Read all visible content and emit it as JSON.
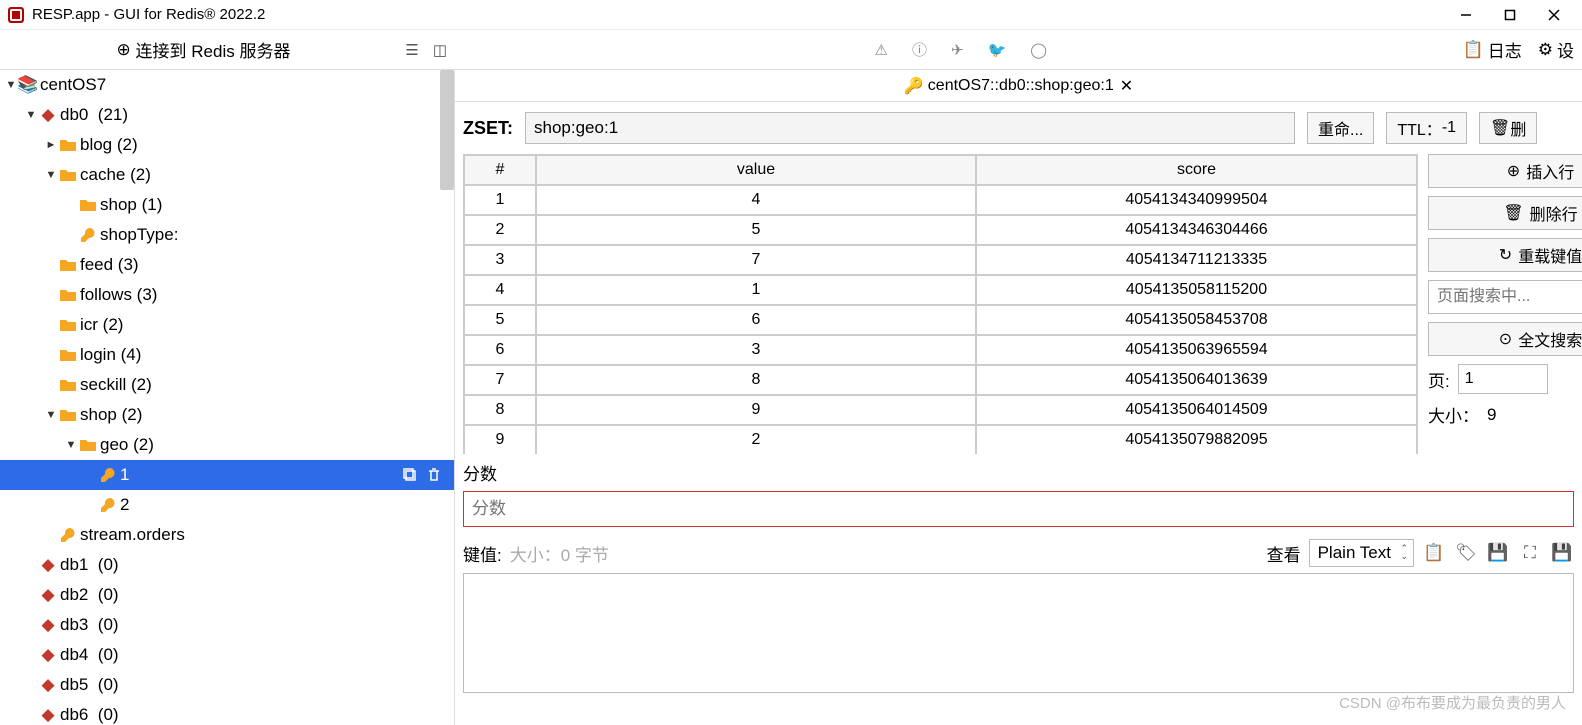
{
  "window": {
    "title": "RESP.app - GUI for Redis® 2022.2"
  },
  "toolbar": {
    "connect": "连接到 Redis 服务器",
    "log": "日志",
    "settings": "设"
  },
  "tree": {
    "server": "centOS7",
    "dbs": [
      {
        "name": "db0",
        "count": "(21)",
        "expanded": true,
        "children": [
          {
            "type": "folder",
            "name": "blog",
            "count": "(2)",
            "arrow": "►",
            "indent": 2
          },
          {
            "type": "folder",
            "name": "cache",
            "count": "(2)",
            "arrow": "▼",
            "indent": 2,
            "children": [
              {
                "type": "folder",
                "name": "shop",
                "count": "(1)",
                "indent": 3
              },
              {
                "type": "key",
                "name": "shopType:",
                "indent": 3
              }
            ]
          },
          {
            "type": "folder",
            "name": "feed",
            "count": "(3)",
            "indent": 2
          },
          {
            "type": "folder",
            "name": "follows",
            "count": "(3)",
            "indent": 2
          },
          {
            "type": "folder",
            "name": "icr",
            "count": "(2)",
            "indent": 2
          },
          {
            "type": "folder",
            "name": "login",
            "count": "(4)",
            "indent": 2
          },
          {
            "type": "folder",
            "name": "seckill",
            "count": "(2)",
            "indent": 2
          },
          {
            "type": "folder",
            "name": "shop",
            "count": "(2)",
            "arrow": "▼",
            "indent": 2,
            "children": [
              {
                "type": "folder",
                "name": "geo",
                "count": "(2)",
                "arrow": "▼",
                "indent": 3,
                "children": [
                  {
                    "type": "key",
                    "name": "1",
                    "indent": 4,
                    "selected": true,
                    "actions": true
                  },
                  {
                    "type": "key",
                    "name": "2",
                    "indent": 4
                  }
                ]
              }
            ]
          },
          {
            "type": "key",
            "name": "stream.orders",
            "indent": 2
          }
        ]
      },
      {
        "name": "db1",
        "count": "(0)"
      },
      {
        "name": "db2",
        "count": "(0)"
      },
      {
        "name": "db3",
        "count": "(0)"
      },
      {
        "name": "db4",
        "count": "(0)"
      },
      {
        "name": "db5",
        "count": "(0)"
      },
      {
        "name": "db6",
        "count": "(0)"
      }
    ]
  },
  "tab": {
    "title": "centOS7::db0::shop:geo:1"
  },
  "key": {
    "type": "ZSET:",
    "name": "shop:geo:1",
    "rename": "重命...",
    "ttl_label": "TTL：",
    "ttl_value": "-1",
    "delete": "删"
  },
  "table": {
    "headers": {
      "num": "#",
      "value": "value",
      "score": "score"
    },
    "rows": [
      {
        "n": "1",
        "v": "4",
        "s": "4054134340999504"
      },
      {
        "n": "2",
        "v": "5",
        "s": "4054134346304466"
      },
      {
        "n": "3",
        "v": "7",
        "s": "4054134711213335"
      },
      {
        "n": "4",
        "v": "1",
        "s": "4054135058115200"
      },
      {
        "n": "5",
        "v": "6",
        "s": "4054135058453708"
      },
      {
        "n": "6",
        "v": "3",
        "s": "4054135063965594"
      },
      {
        "n": "7",
        "v": "8",
        "s": "4054135064013639"
      },
      {
        "n": "8",
        "v": "9",
        "s": "4054135064014509"
      },
      {
        "n": "9",
        "v": "2",
        "s": "4054135079882095"
      }
    ]
  },
  "side": {
    "insert": "插入行",
    "delrow": "删除行",
    "reload": "重载键值",
    "search_placeholder": "页面搜索中...",
    "fulltext": "全文搜索",
    "page_label": "页:",
    "page_value": "1",
    "size_label": "大小：",
    "size_value": "9"
  },
  "score": {
    "label": "分数",
    "placeholder": "分数"
  },
  "kv": {
    "label": "键值:",
    "sizetext": "大小：0 字节",
    "view_label": "查看",
    "view_value": "Plain Text"
  },
  "watermark": "CSDN @布布要成为最负责的男人"
}
